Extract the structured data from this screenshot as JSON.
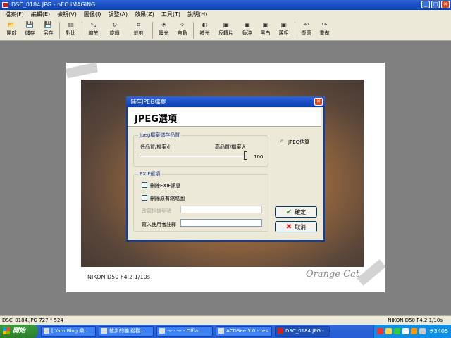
{
  "window": {
    "title": "DSC_0184.JPG - nEO iMAGING",
    "min": "_",
    "max": "□",
    "close": "✕"
  },
  "menu": [
    "檔案(F)",
    "編輯(E)",
    "檢視(V)",
    "圖像(I)",
    "調整(A)",
    "效果(Z)",
    "工具(T)",
    "說明(H)"
  ],
  "toolbar": [
    {
      "icon": "open-icon",
      "glyph": "📂",
      "label": "開啟"
    },
    {
      "icon": "save-icon",
      "glyph": "💾",
      "label": "儲存"
    },
    {
      "icon": "save-as-icon",
      "glyph": "💾",
      "label": "另存"
    },
    {
      "icon": "compare-icon",
      "glyph": "▥",
      "label": "對比"
    },
    {
      "icon": "resize-icon",
      "glyph": "⤡",
      "label": "縮放"
    },
    {
      "icon": "rotate-icon",
      "glyph": "↻",
      "label": "旋轉"
    },
    {
      "icon": "crop-icon",
      "glyph": "⌗",
      "label": "裁剪"
    },
    {
      "icon": "exposure-icon",
      "glyph": "☀",
      "label": "曝光"
    },
    {
      "icon": "auto-icon",
      "glyph": "✧",
      "label": "自動"
    },
    {
      "icon": "fill-light-icon",
      "glyph": "◐",
      "label": "補光"
    },
    {
      "icon": "reverse-film-icon",
      "glyph": "▣",
      "label": "反轉片"
    },
    {
      "icon": "negative-icon",
      "glyph": "▣",
      "label": "負沖"
    },
    {
      "icon": "bw-icon",
      "glyph": "▣",
      "label": "黑白"
    },
    {
      "icon": "sepia-icon",
      "glyph": "▣",
      "label": "舊相"
    },
    {
      "icon": "undo-icon",
      "glyph": "↶",
      "label": "復原"
    },
    {
      "icon": "redo-icon",
      "glyph": "↷",
      "label": "重做"
    }
  ],
  "photo": {
    "caption_left": "NIKON D50 F4.2 1/10s",
    "caption_right": "Orange Cat"
  },
  "dialog": {
    "title": "儲存JPEG檔案",
    "header": "JPEG選項",
    "quality_group": "Jpeg檔案儲存品質",
    "low_label": "低品質/檔案小",
    "high_label": "高品質/檔案大",
    "quality_value": "100",
    "estimate_label": "JPEG估算",
    "exif_group": "EXIF選項",
    "remove_exif": "刪除EXIF訊息",
    "remove_thumbs": "刪除原有縮略圖",
    "camera_model_label": "改寫相機型號",
    "user_comment_label": "寫入使用者註釋",
    "ok": "確定",
    "cancel": "取消"
  },
  "status": {
    "left": "DSC_0184.JPG  727 * 524",
    "right": "NIKON D50 F4.2 1/10s"
  },
  "taskbar": {
    "start": "開始",
    "items": [
      "[ Yam Blog 樂...",
      "散步的貓 從觀...",
      "～ · ～ - Offla...",
      "ACDSee 5.0 - res...",
      "DSC_0184.JPG -..."
    ],
    "tray_text": "#3405"
  },
  "colors": {
    "titlebar": "#0a3fb4",
    "taskbar": "#245dd7",
    "start": "#2a7f2a"
  }
}
